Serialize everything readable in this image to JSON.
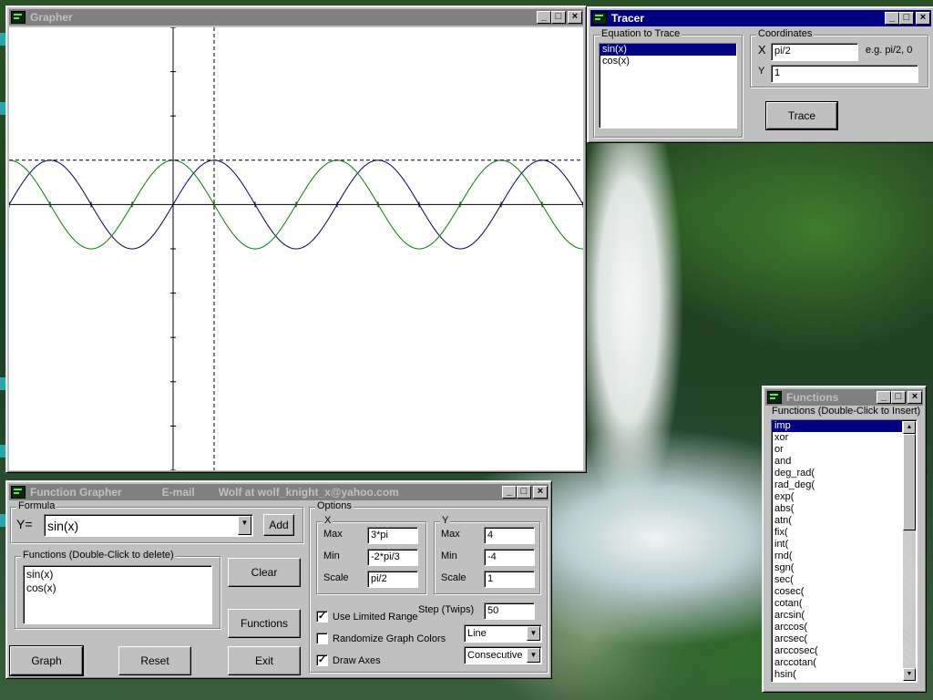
{
  "grapher": {
    "title": "Grapher",
    "chart_data": {
      "type": "line",
      "x_range": [
        -6.2832,
        15.708
      ],
      "y_range": [
        -6,
        4
      ],
      "x_scale": "pi/2",
      "y_scale": 1,
      "axes_drawn": true,
      "trace_point": [
        1.5708,
        1
      ],
      "series": [
        {
          "name": "sin(x)",
          "color": "#000060",
          "function": "sin"
        },
        {
          "name": "cos(x)",
          "color": "#008000",
          "function": "cos"
        }
      ]
    }
  },
  "tracer": {
    "title": "Tracer",
    "equation_group": "Equation to Trace",
    "equations": [
      "sin(x)",
      "cos(x)"
    ],
    "selected_equation": "sin(x)",
    "coordinates_group": "Coordinates",
    "x_label": "X",
    "x_value": "pi/2",
    "example_hint": "e.g.  pi/2, 0",
    "y_label": "Y",
    "y_value": "1",
    "trace_button": "Trace"
  },
  "functions_window": {
    "title": "Functions",
    "caption": "Functions (Double-Click to Insert)",
    "items": [
      "imp",
      "xor",
      "or",
      "and",
      "deg_rad(",
      "rad_deg(",
      "exp(",
      "abs(",
      "atn(",
      "fix(",
      "int(",
      "rnd(",
      "sgn(",
      "sec(",
      "cosec(",
      "cotan(",
      "arcsin(",
      "arccos(",
      "arcsec(",
      "arccosec(",
      "arccotan(",
      "hsin("
    ],
    "selected_item": "imp"
  },
  "function_grapher": {
    "title": "Function Grapher",
    "email_label": "E-mail",
    "author": "Wolf at wolf_knight_x@yahoo.com",
    "formula_group": "Formula",
    "y_label": "Y=",
    "formula_value": "sin(x)",
    "add_button": "Add",
    "functions_group": "Functions (Double-Click to delete)",
    "functions": [
      "sin(x)",
      "cos(x)"
    ],
    "clear_button": "Clear",
    "functions_button": "Functions",
    "graph_button": "Graph",
    "reset_button": "Reset",
    "exit_button": "Exit",
    "options_group": "Options",
    "x_group": "X",
    "y_group": "Y",
    "max_label": "Max",
    "min_label": "Min",
    "scale_label": "Scale",
    "x_max": "3*pi",
    "x_min": "-2*pi/3",
    "x_scale": "pi/2",
    "y_max": "4",
    "y_min": "-4",
    "y_scale": "1",
    "use_limited_range_label": "Use Limited Range",
    "use_limited_range": true,
    "randomize_colors_label": "Randomize Graph Colors",
    "randomize_colors": false,
    "draw_axes_label": "Draw Axes",
    "draw_axes": true,
    "step_label": "Step (Twips)",
    "step_value": "50",
    "line_style": "Line",
    "plot_mode": "Consecutive"
  }
}
